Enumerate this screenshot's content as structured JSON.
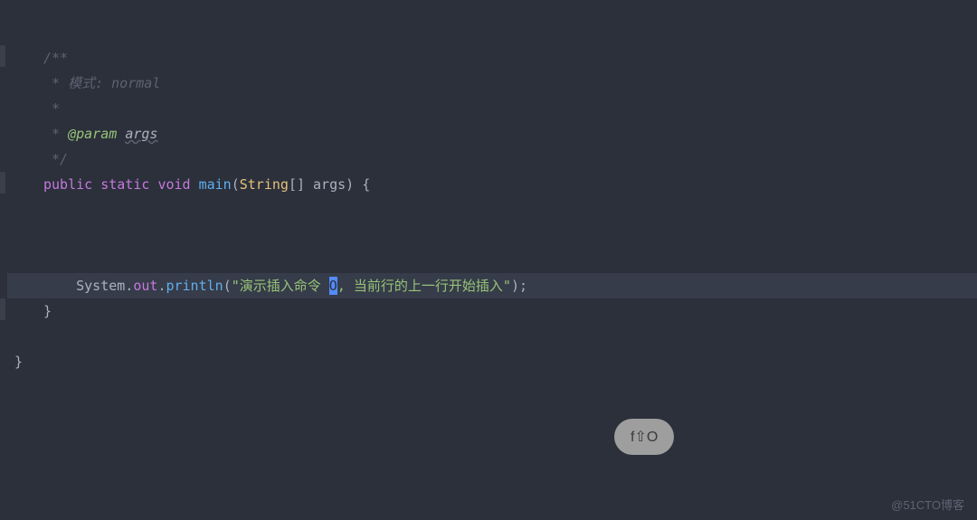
{
  "code": {
    "doc_open": "/**",
    "doc_line1_prefix": " * ",
    "doc_line1_text": "模式: normal",
    "doc_line2": " *",
    "doc_line3_prefix": " * ",
    "doc_tag": "@param",
    "doc_param": "args",
    "doc_close": " */",
    "kw_public": "public",
    "kw_static": "static",
    "kw_void": "void",
    "method_main": "main",
    "type_string": "String",
    "brackets": "[]",
    "param_args": "args",
    "brace_open": "{",
    "sys": "System",
    "dot1": ".",
    "out": "out",
    "dot2": ".",
    "println": "println",
    "paren_open": "(",
    "str_open": "\"",
    "str_part1": "演示插入命令 ",
    "cursor_char": "O",
    "str_part2": ", 当前行的上一行开始插入",
    "str_close": "\"",
    "paren_close": ")",
    "semicolon": ";",
    "brace_close_method": "}",
    "brace_close_class": "}"
  },
  "keybind": {
    "text": "f⇧O"
  },
  "watermark": "@51CTO博客"
}
